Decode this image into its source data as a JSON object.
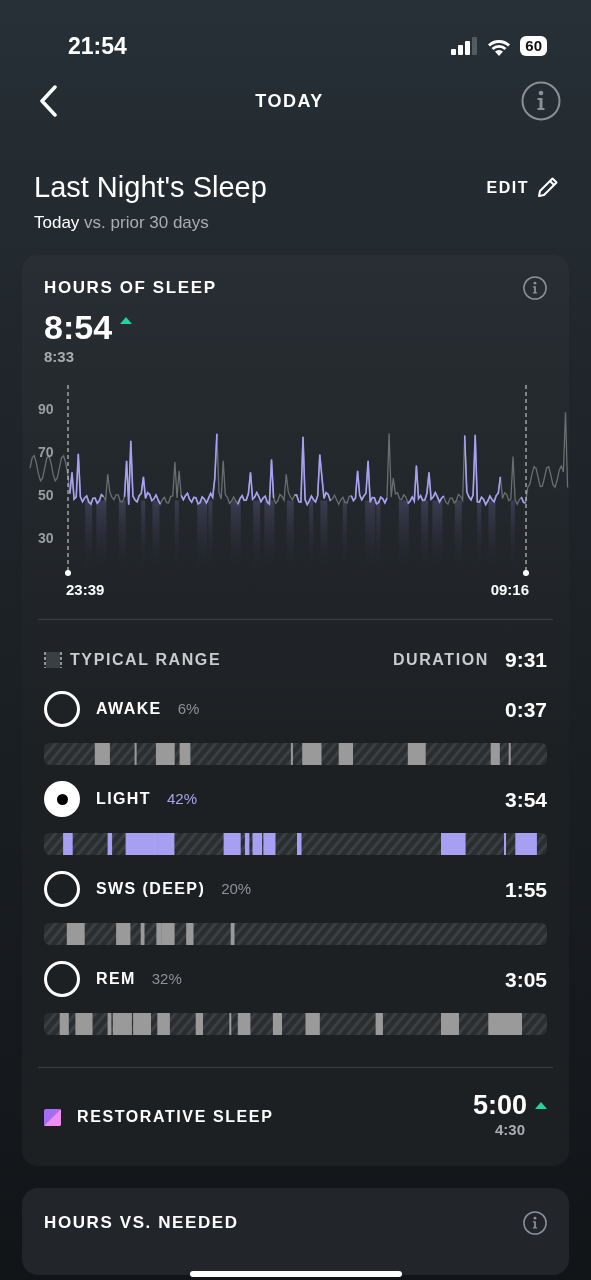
{
  "status_bar": {
    "time": "21:54",
    "battery": "60"
  },
  "header": {
    "title": "TODAY"
  },
  "summary": {
    "title": "Last Night's Sleep",
    "subtitle_bold": "Today",
    "subtitle": "vs. prior 30 days",
    "edit": "EDIT"
  },
  "hours_card": {
    "title": "HOURS OF SLEEP",
    "value": "8:54",
    "improved": true,
    "baseline": "8:33",
    "y_labels": [
      "90",
      "70",
      "50",
      "30"
    ],
    "start_time": "23:39",
    "end_time": "09:16"
  },
  "legend": {
    "typical_range": "TYPICAL RANGE",
    "duration_label": "DURATION",
    "duration": "9:31"
  },
  "stages": [
    {
      "name": "AWAKE",
      "percent": "6%",
      "duration": "0:37",
      "selected": false
    },
    {
      "name": "LIGHT",
      "percent": "42%",
      "duration": "3:54",
      "selected": true
    },
    {
      "name": "SWS (DEEP)",
      "percent": "20%",
      "duration": "1:55",
      "selected": false
    },
    {
      "name": "REM",
      "percent": "32%",
      "duration": "3:05",
      "selected": false
    }
  ],
  "restorative": {
    "label": "RESTORATIVE SLEEP",
    "value": "5:00",
    "improved": true,
    "baseline": "4:30"
  },
  "next_card": {
    "title": "HOURS VS. NEEDED"
  }
}
